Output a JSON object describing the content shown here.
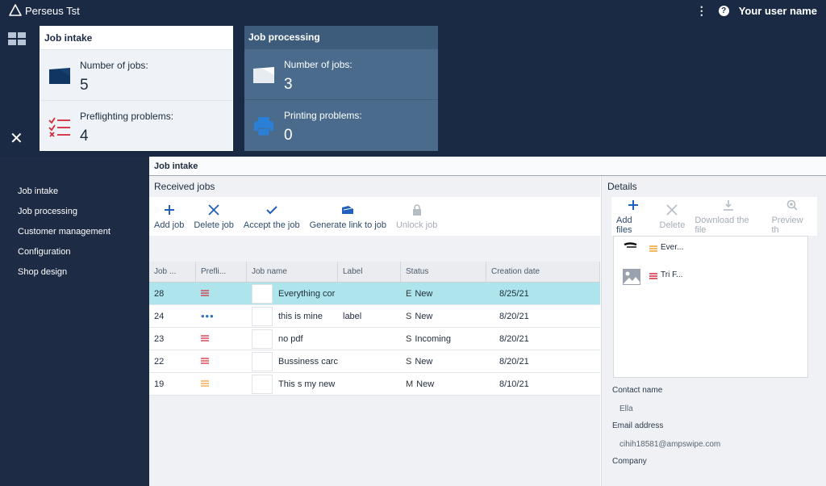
{
  "app": {
    "title": "Perseus Tst",
    "user": "Your user name"
  },
  "dashboard": {
    "job_intake": {
      "title": "Job intake",
      "jobs_label": "Number of jobs:",
      "jobs_value": "5",
      "problems_label": "Preflighting problems:",
      "problems_value": "4"
    },
    "job_processing": {
      "title": "Job processing",
      "jobs_label": "Number of jobs:",
      "jobs_value": "3",
      "problems_label": "Printing problems:",
      "problems_value": "0"
    }
  },
  "sidebar": {
    "items": [
      {
        "label": "Job intake"
      },
      {
        "label": "Job processing"
      },
      {
        "label": "Customer management"
      },
      {
        "label": "Configuration"
      },
      {
        "label": "Shop design"
      }
    ]
  },
  "section": {
    "title": "Job intake"
  },
  "received": {
    "title": "Received jobs",
    "toolbar": [
      {
        "label": "Add job",
        "icon": "plus-icon",
        "enabled": true
      },
      {
        "label": "Delete job",
        "icon": "close-icon",
        "enabled": true
      },
      {
        "label": "Accept the job",
        "icon": "check-icon",
        "enabled": true
      },
      {
        "label": "Generate link to job",
        "icon": "link-icon",
        "enabled": true
      },
      {
        "label": "Unlock job",
        "icon": "lock-icon",
        "enabled": false
      }
    ],
    "columns": [
      "Job ...",
      "Prefli...",
      "Job name",
      "Label",
      "Status",
      "Creation date"
    ],
    "rows": [
      {
        "id": "28",
        "preflight": "problem",
        "name": "Everything cor",
        "label": "",
        "s": "E",
        "status": "New",
        "date": "8/25/21",
        "selected": true
      },
      {
        "id": "24",
        "preflight": "pending",
        "name": "this is mine",
        "label": "label",
        "s": "S",
        "status": "New",
        "date": "8/20/21",
        "selected": false
      },
      {
        "id": "23",
        "preflight": "problem",
        "name": "no pdf",
        "label": "",
        "s": "S",
        "status": "Incoming",
        "date": "8/20/21",
        "selected": false
      },
      {
        "id": "22",
        "preflight": "problem",
        "name": "Bussiness carc",
        "label": "",
        "s": "S",
        "status": "New",
        "date": "8/20/21",
        "selected": false
      },
      {
        "id": "19",
        "preflight": "warning",
        "name": "This s my new",
        "label": "",
        "s": "M",
        "status": "New",
        "date": "8/10/21",
        "selected": false
      }
    ]
  },
  "details": {
    "title": "Details",
    "toolbar": [
      {
        "label": "Add files",
        "icon": "plus-icon",
        "enabled": true
      },
      {
        "label": "Delete",
        "icon": "close-icon",
        "enabled": false
      },
      {
        "label": "Download the file",
        "icon": "download-icon",
        "enabled": false
      },
      {
        "label": "Preview th",
        "icon": "preview-icon",
        "enabled": false
      }
    ],
    "files": [
      {
        "name": "Ever...",
        "status": "warning"
      },
      {
        "name": "Tri F...",
        "status": "problem"
      }
    ],
    "contact_label": "Contact name",
    "contact_value": "Ella",
    "email_label": "Email address",
    "email_value": "cihih18581@ampswipe.com",
    "company_label": "Company"
  },
  "colors": {
    "navy": "#1b2a44",
    "selection": "#aee5ec",
    "accent": "#1f5fbf",
    "problem": "#d6283a",
    "warning": "#f0a030"
  }
}
